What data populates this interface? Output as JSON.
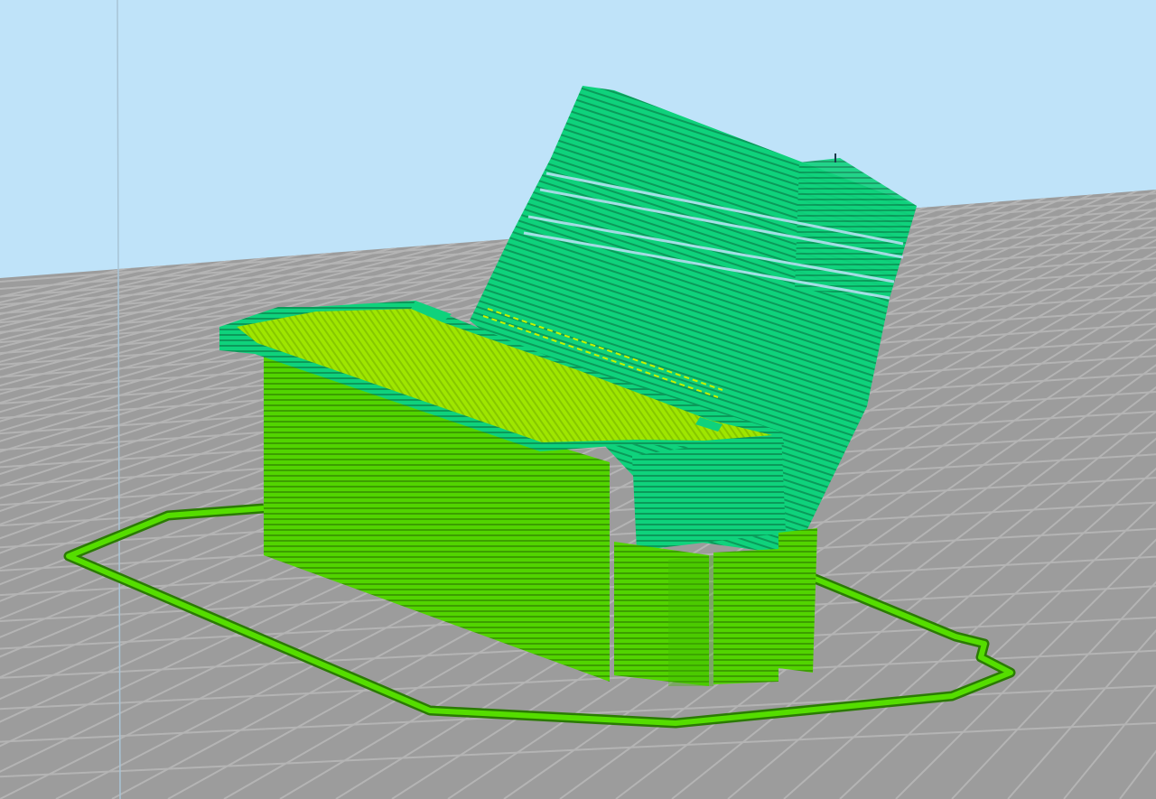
{
  "viewport": {
    "name": "3d-layer-preview",
    "colors": {
      "sky": "#bfe3f9",
      "bed": "#9c9c9c",
      "grid_line": "#b4b4b4",
      "perimeter": "#55dd00",
      "perimeter_dark": "#2b7a05",
      "wall": "#52d400",
      "wall_line": "#3c9e00",
      "support": "#0fd27c",
      "support_line": "#0b9a5a",
      "top_infill": "#9fe600",
      "top_infill_line": "#86c700"
    }
  }
}
